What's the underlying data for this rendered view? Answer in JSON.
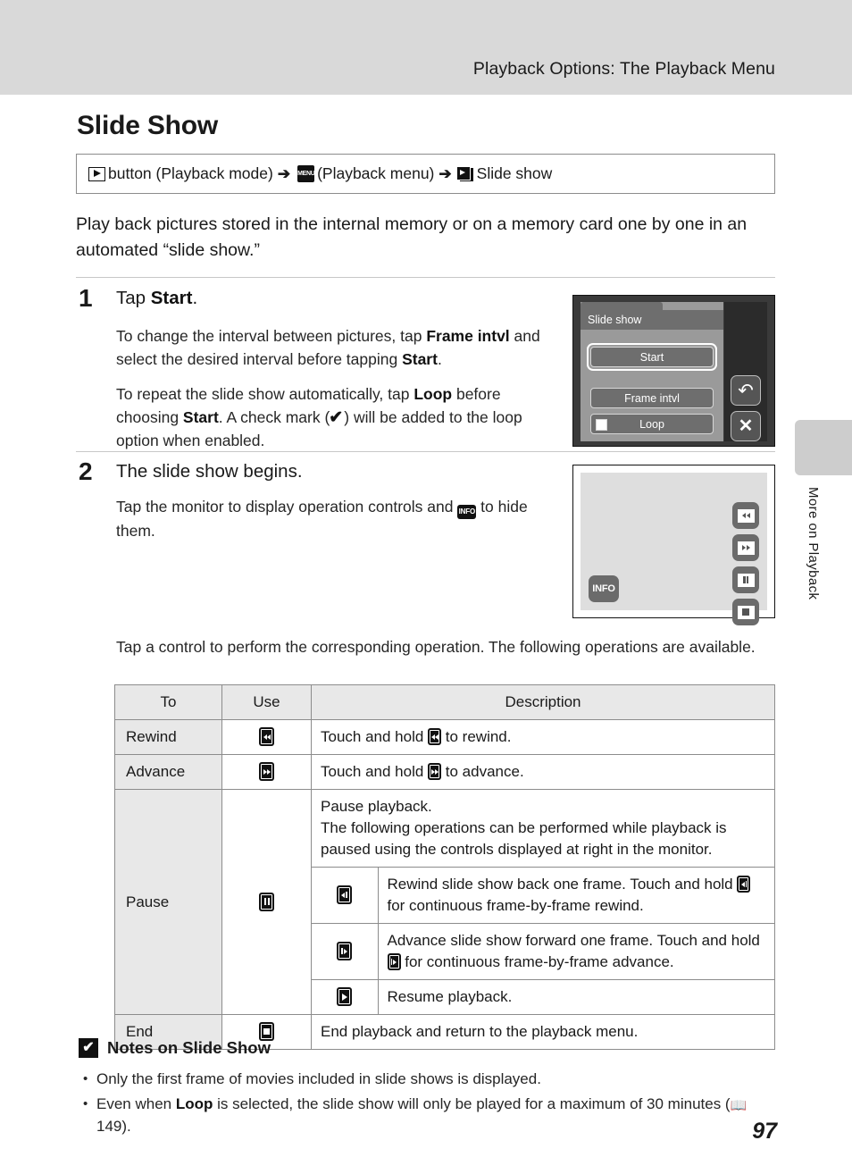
{
  "header": {
    "running_title": "Playback Options: The Playback Menu"
  },
  "side_tab": {
    "label": "More on Playback"
  },
  "page": {
    "title": "Slide Show",
    "number": "97"
  },
  "command_path": {
    "playback_icon": "playback-button-icon",
    "text1": "button (Playback mode)",
    "arrow1": "➔",
    "menu_icon": "MENU",
    "text2": "(Playback menu)",
    "arrow2": "➔",
    "slideshow_icon": "slide-show-icon",
    "text3": "Slide show"
  },
  "intro": "Play back pictures stored in the internal memory or on a memory card one by one in an automated “slide show.”",
  "steps": [
    {
      "number": "1",
      "heading_prefix": "Tap ",
      "heading_bold": "Start",
      "heading_suffix": ".",
      "paragraph1": {
        "a": "To change the interval between pictures, tap ",
        "b1": "Frame intvl",
        "c": " and select the desired interval before tapping ",
        "b2": "Start",
        "d": "."
      },
      "paragraph2": {
        "a": "To repeat the slide show automatically, tap ",
        "b1": "Loop",
        "c": " before choosing ",
        "b2": "Start",
        "d": ". A check mark (",
        "e": ") will be added to the loop option when enabled."
      }
    },
    {
      "number": "2",
      "heading": "The slide show begins.",
      "paragraph": {
        "a": "Tap the monitor to display operation controls and ",
        "icon": "INFO",
        "b": " to hide them."
      }
    }
  ],
  "screen1": {
    "title": "Slide show",
    "buttons": [
      {
        "label": "Start",
        "selected": true
      },
      {
        "label": "Frame intvl",
        "selected": false
      },
      {
        "label": "Loop",
        "selected": false,
        "checkbox": true
      }
    ],
    "side_buttons": [
      {
        "name": "back-icon",
        "glyph": "↶"
      },
      {
        "name": "close-icon",
        "glyph": "✕"
      }
    ]
  },
  "screen2": {
    "controls": [
      {
        "name": "rewind-icon"
      },
      {
        "name": "advance-icon"
      },
      {
        "name": "pause-icon"
      },
      {
        "name": "stop-icon"
      }
    ],
    "info_label": "INFO"
  },
  "table_lead": "Tap a control to perform the corresponding operation. The following operations are available.",
  "table": {
    "headers": {
      "to": "To",
      "use": "Use",
      "description": "Description"
    },
    "rows": [
      {
        "to": "Rewind",
        "use_icon": "rewind-key-icon",
        "desc_a": "Touch and hold ",
        "desc_icon": "rewind-key-icon",
        "desc_b": " to rewind."
      },
      {
        "to": "Advance",
        "use_icon": "advance-key-icon",
        "desc_a": "Touch and hold ",
        "desc_icon": "advance-key-icon",
        "desc_b": " to advance."
      }
    ],
    "pause_row": {
      "to": "Pause",
      "use_icon": "pause-key-icon",
      "intro_line1": "Pause playback.",
      "intro_line2": "The following operations can be performed while playback is paused using the controls displayed at right in the monitor.",
      "sub_rows": [
        {
          "icon": "frame-rewind-key-icon",
          "text_a": "Rewind slide show back one frame. Touch and hold ",
          "text_icon": "frame-rewind-key-icon",
          "text_b": " for continuous frame-by-frame rewind."
        },
        {
          "icon": "frame-advance-key-icon",
          "text_a": "Advance slide show forward one frame. Touch and hold ",
          "text_icon": "frame-advance-key-icon",
          "text_b": " for continuous frame-by-frame advance."
        },
        {
          "icon": "resume-play-key-icon",
          "text_a": "Resume playback.",
          "text_icon": "",
          "text_b": ""
        }
      ]
    },
    "end_row": {
      "to": "End",
      "use_icon": "stop-key-icon",
      "desc": "End playback and return to the playback menu."
    }
  },
  "notes": {
    "heading": "Notes on Slide Show",
    "items": [
      {
        "text_a": "Only the first frame of movies included in slide shows is displayed."
      },
      {
        "text_a": "Even when ",
        "bold": "Loop",
        "text_b": " is selected, the slide show will only be played for a maximum of 30 minutes (",
        "ref": "149",
        "text_c": ")."
      }
    ]
  }
}
